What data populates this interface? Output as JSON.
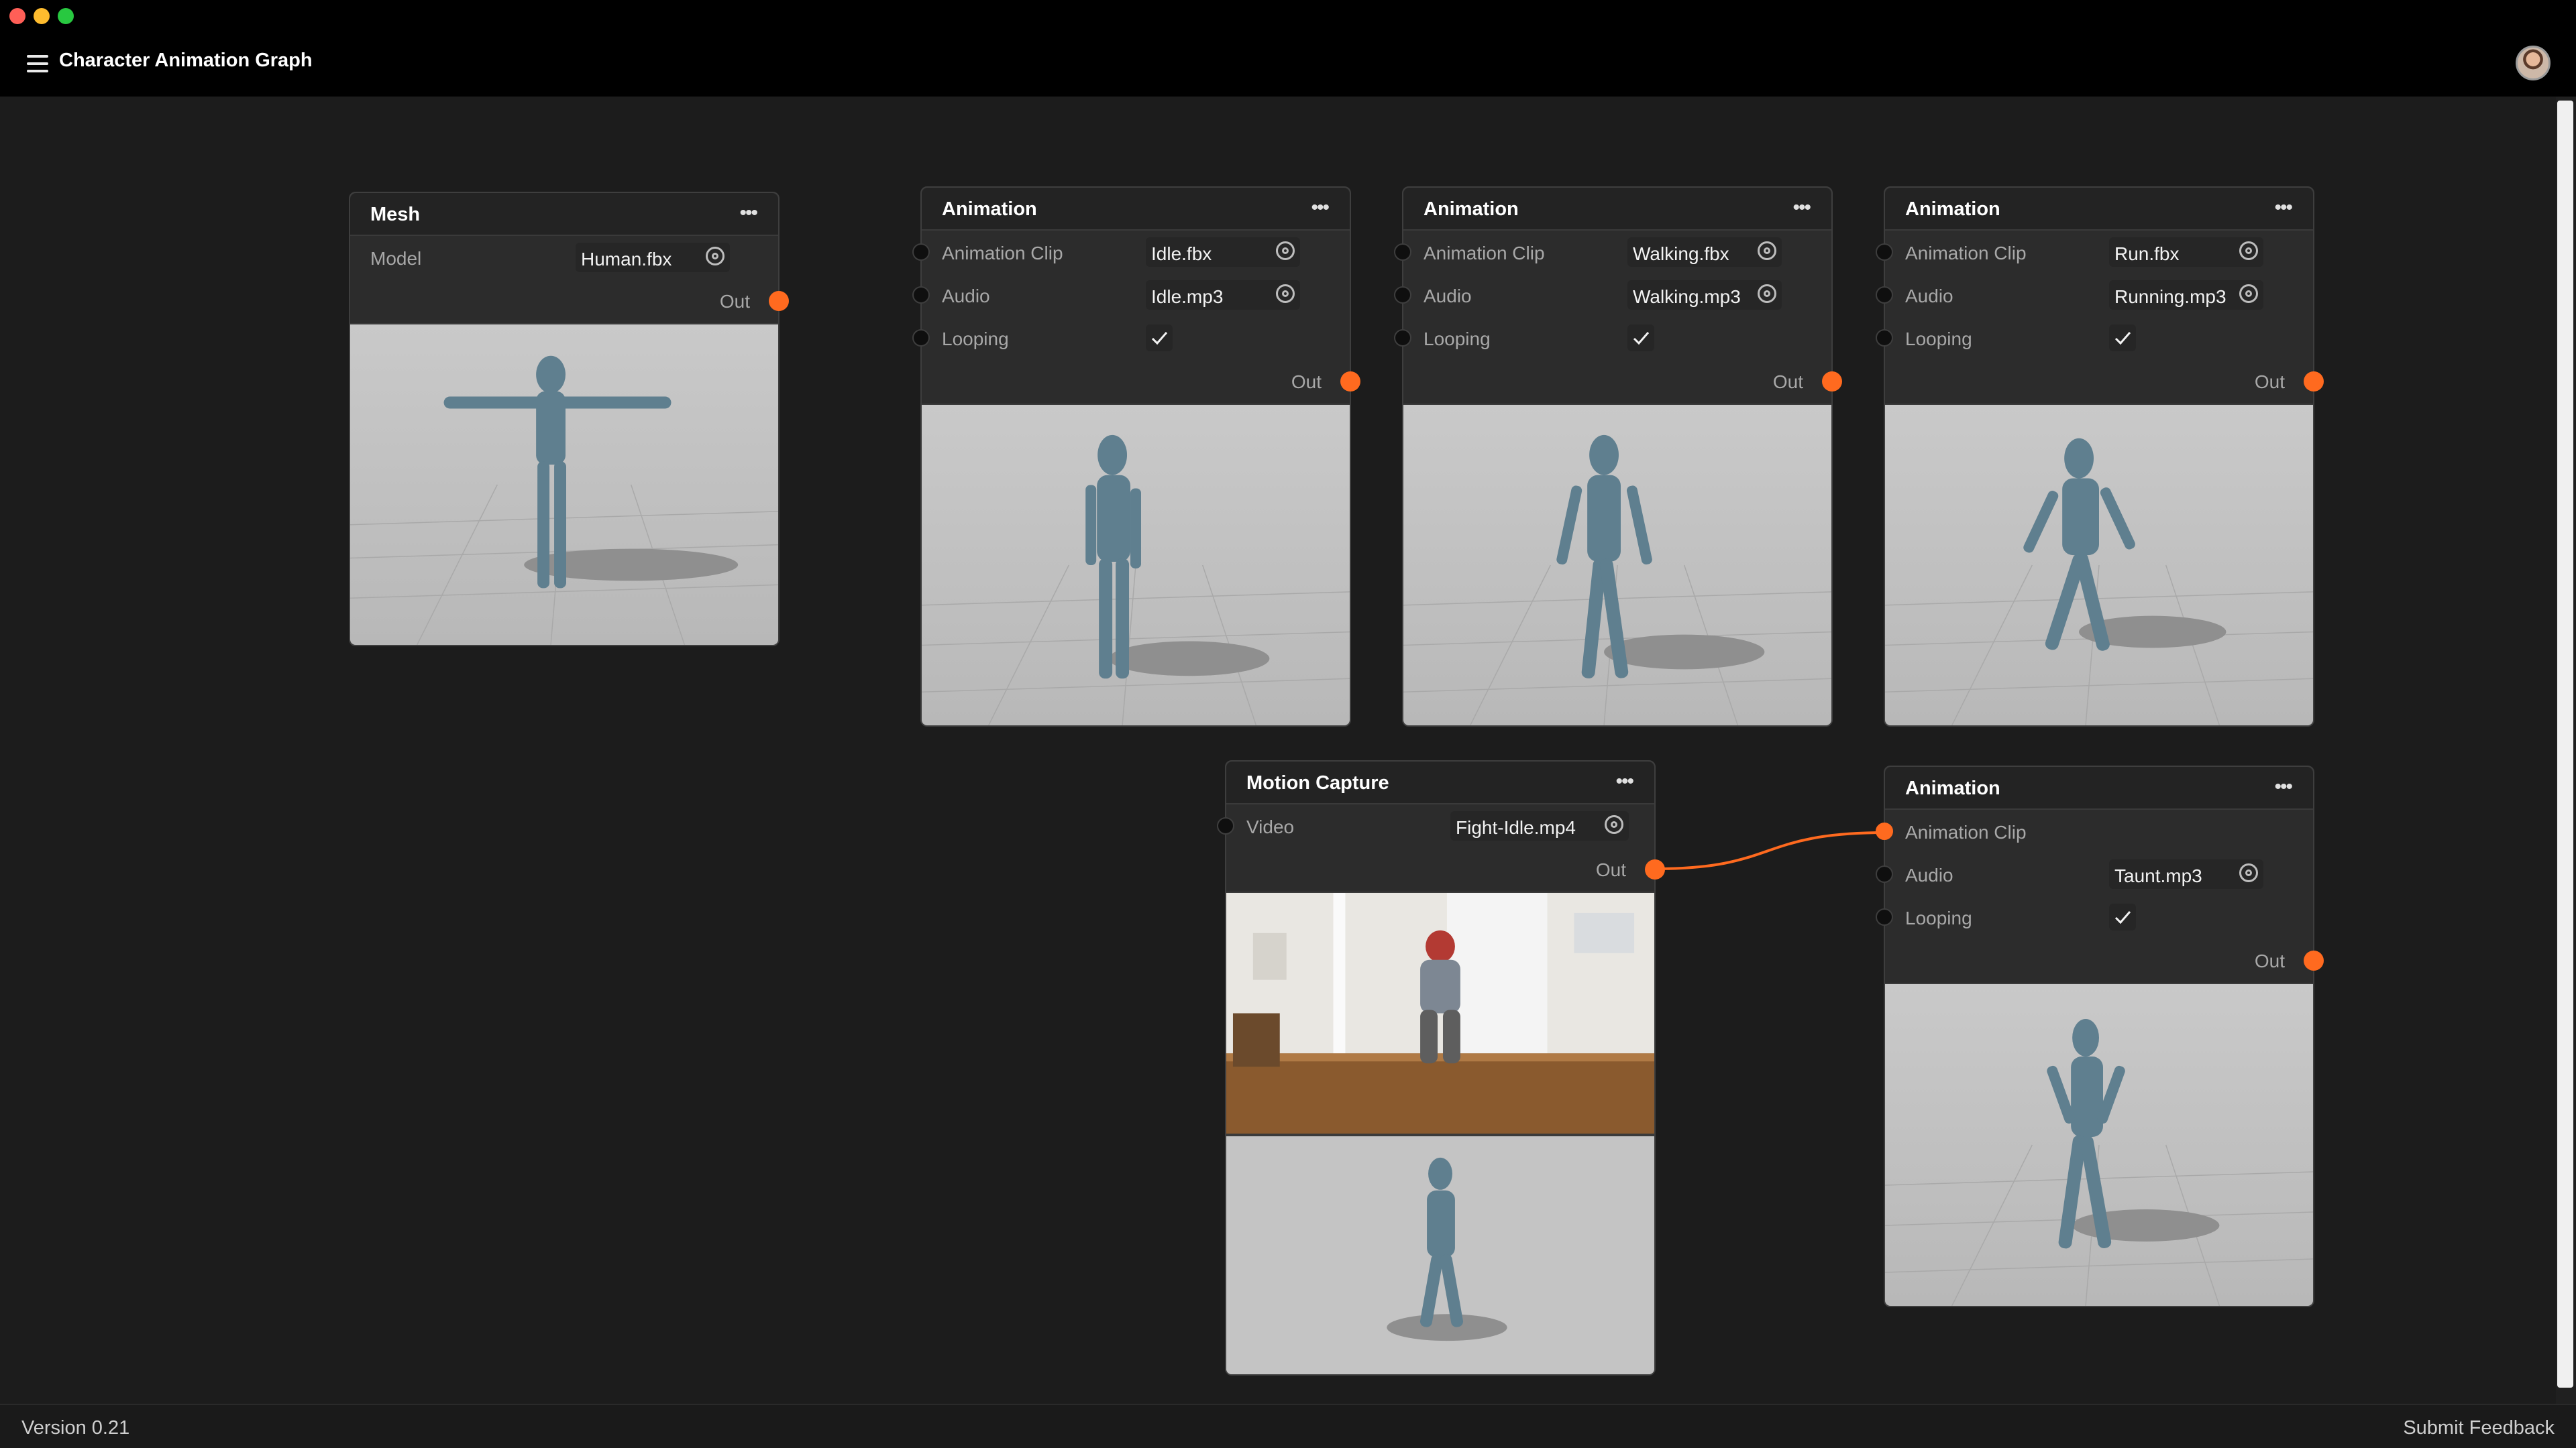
{
  "window": {
    "title": "Character Animation Graph"
  },
  "status": {
    "version": "Version 0.21",
    "feedback": "Submit Feedback"
  },
  "nodes": {
    "mesh": {
      "title": "Mesh",
      "model_label": "Model",
      "model_value": "Human.fbx",
      "out_label": "Out"
    },
    "anim1": {
      "title": "Animation",
      "clip_label": "Animation Clip",
      "clip_value": "Idle.fbx",
      "audio_label": "Audio",
      "audio_value": "Idle.mp3",
      "looping_label": "Looping",
      "looping": true,
      "out_label": "Out"
    },
    "anim2": {
      "title": "Animation",
      "clip_label": "Animation Clip",
      "clip_value": "Walking.fbx",
      "audio_label": "Audio",
      "audio_value": "Walking.mp3",
      "looping_label": "Looping",
      "looping": true,
      "out_label": "Out"
    },
    "anim3": {
      "title": "Animation",
      "clip_label": "Animation Clip",
      "clip_value": "Run.fbx",
      "audio_label": "Audio",
      "audio_value": "Running.mp3",
      "looping_label": "Looping",
      "looping": true,
      "out_label": "Out"
    },
    "mocap": {
      "title": "Motion Capture",
      "video_label": "Video",
      "video_value": "Fight-Idle.mp4",
      "out_label": "Out"
    },
    "anim4": {
      "title": "Animation",
      "clip_label": "Animation Clip",
      "audio_label": "Audio",
      "audio_value": "Taunt.mp3",
      "looping_label": "Looping",
      "looping": true,
      "out_label": "Out"
    }
  },
  "colors": {
    "accent": "#ff6a1f",
    "node_bg": "#2c2c2c",
    "canvas_bg": "#1c1c1c",
    "figure": "#5f7f8f"
  },
  "icons": [
    "menu-icon",
    "more-icon",
    "target-icon",
    "check-icon",
    "avatar"
  ]
}
